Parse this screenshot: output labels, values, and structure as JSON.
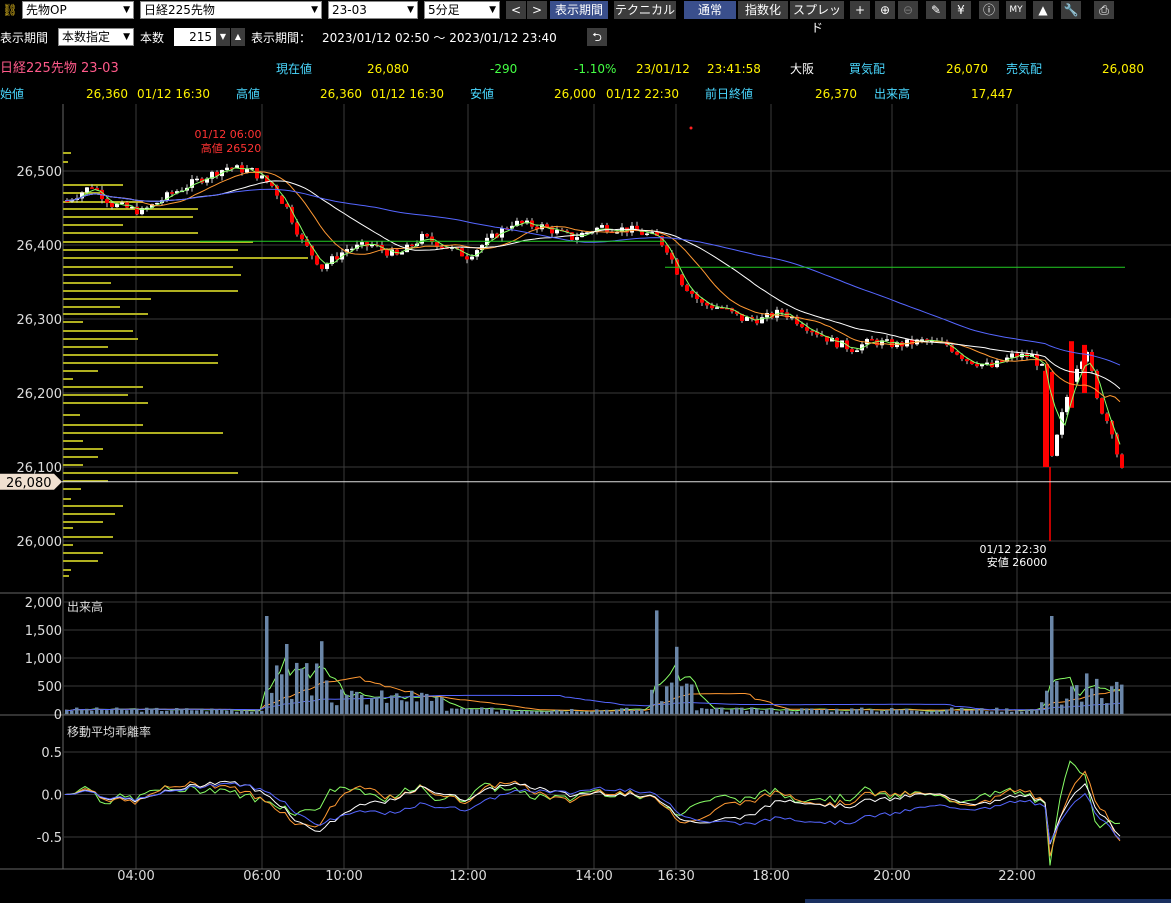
{
  "toolbar": {
    "product_type": "先物OP",
    "product": "日経225先物",
    "contract": "23-03",
    "interval": "5分足",
    "display_period_btn": "表示期間",
    "technical_btn": "テクニカル",
    "normal_btn": "通常",
    "index_btn": "指数化",
    "spread_btn": "スプレッド",
    "icons": [
      "chevron-left-icon",
      "chevron-right-icon",
      "crosshair-icon",
      "zoom-in-icon",
      "zoom-out-icon",
      "pencil-icon",
      "yen-icon",
      "info-icon",
      "my-icon",
      "mountain-icon",
      "wrench-icon",
      "print-icon"
    ]
  },
  "period": {
    "label": "表示期間",
    "mode": "本数指定",
    "count_label": "本数",
    "count": "215",
    "range_label": "表示期間：",
    "range": "2023/01/12 02:50 ～ 2023/01/12 23:40"
  },
  "quote": {
    "name": "日経225先物 23-03",
    "current_label": "現在値",
    "current": "26,080",
    "change": "-290",
    "change_pct": "-1.10%",
    "date": "23/01/12",
    "time": "23:41:58",
    "market": "大阪",
    "bid_label": "買気配",
    "bid": "26,070",
    "ask_label": "売気配",
    "ask": "26,080",
    "open_label": "始値",
    "open": "26,360",
    "open_time": "01/12 16:30",
    "high_label": "高値",
    "high": "26,360",
    "high_time": "01/12 16:30",
    "low_label": "安値",
    "low": "26,000",
    "low_time": "01/12 22:30",
    "prev_close_label": "前日終値",
    "prev_close": "26,370",
    "volume_label": "出来高",
    "volume": "17,447"
  },
  "chart_data": [
    {
      "type": "candlestick",
      "price_ticks": [
        "26,500",
        "26,400",
        "26,300",
        "26,200",
        "26,100",
        "26,000"
      ],
      "ylim": [
        25980,
        26560
      ],
      "current_price_tag": "26,080",
      "high_annotation": {
        "time": "01/12 06:00",
        "text": "高値 26520"
      },
      "low_annotation": {
        "time": "01/12 22:30",
        "text": "安値 26000"
      },
      "reference_line": 26370,
      "colors": {
        "up": "#ffffff",
        "down": "#ff0000",
        "ma_short": "#ffffff",
        "ma_mid": "#ff9933",
        "ma_long": "#5566ff",
        "ma_green": "#88ff66",
        "volume_profile": "#b0b020"
      }
    },
    {
      "type": "bar",
      "title": "出来高",
      "y_ticks": [
        "2,000",
        "1,500",
        "1,000",
        "500",
        "0"
      ],
      "ylim": [
        0,
        2000
      ]
    },
    {
      "type": "line",
      "title": "移動平均乖離率",
      "y_ticks": [
        "0.5",
        "0.0",
        "-0.5"
      ],
      "ylim": [
        -0.75,
        0.75
      ]
    }
  ],
  "time_axis": [
    "04:00",
    "06:00",
    "10:00",
    "12:00",
    "14:00",
    "16:30",
    "18:00",
    "20:00",
    "22:00"
  ]
}
